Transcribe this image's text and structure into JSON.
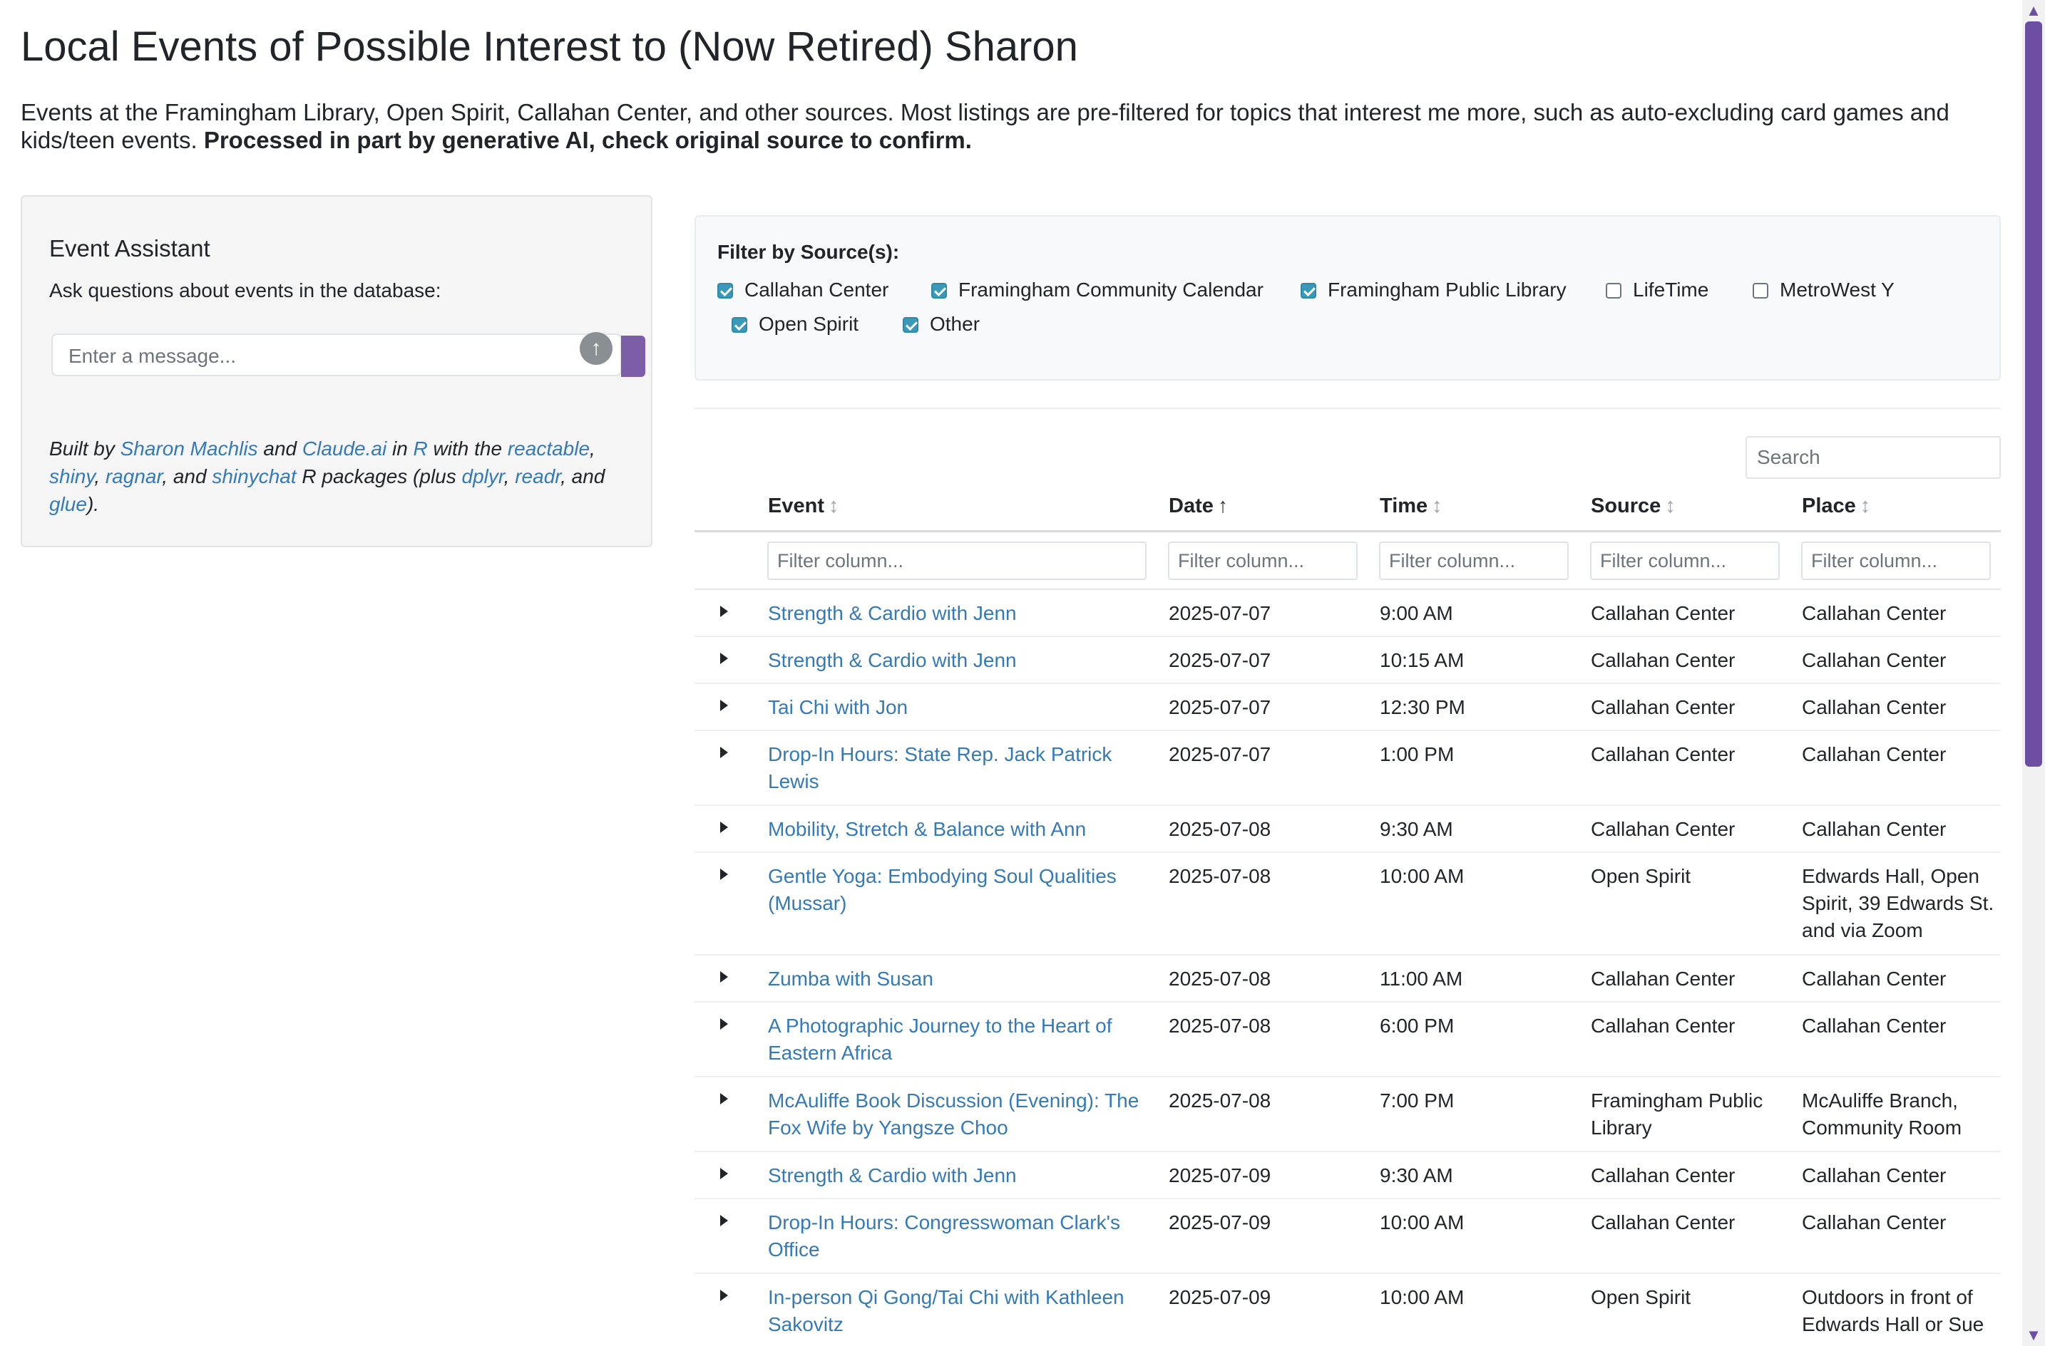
{
  "page": {
    "title": "Local Events of Possible Interest to (Now Retired) Sharon",
    "intro_text": "Events at the Framingham Library, Open Spirit, Callahan Center, and other sources. Most listings are pre-filtered for topics that interest me more, such as auto-excluding card games and kids/teen events. ",
    "intro_bold": "Processed in part by generative AI, check original source to confirm."
  },
  "assistant": {
    "title": "Event Assistant",
    "prompt": "Ask questions about events in the database:",
    "input_placeholder": "Enter a message...",
    "send_icon": "arrow-up-icon",
    "credits": {
      "built_by": "Built by ",
      "author": "Sharon Machlis",
      "and1": " and ",
      "ai": "Claude.ai",
      "in": " in ",
      "lang": "R",
      "with": " with the ",
      "pkg1": "reactable",
      "c1": ", ",
      "pkg2": "shiny",
      "c2": ", ",
      "pkg3": "ragnar",
      "c3": ", and ",
      "pkg4": "shinychat",
      "mid": " R packages (plus ",
      "pkg5": "dplyr",
      "c4": ", ",
      "pkg6": "readr",
      "c5": ", and ",
      "pkg7": "glue",
      "end": ")."
    }
  },
  "filters": {
    "title": "Filter by Source(s):",
    "sources": [
      {
        "label": "Callahan Center",
        "checked": true
      },
      {
        "label": "Framingham Community Calendar",
        "checked": true
      },
      {
        "label": "Framingham Public Library",
        "checked": true
      },
      {
        "label": "LifeTime",
        "checked": false
      },
      {
        "label": "MetroWest Y",
        "checked": false
      },
      {
        "label": "Open Spirit",
        "checked": true
      },
      {
        "label": "Other",
        "checked": true
      }
    ]
  },
  "table": {
    "search_placeholder": "Search",
    "filter_placeholder": "Filter column...",
    "headers": {
      "event": "Event",
      "date": "Date",
      "time": "Time",
      "source": "Source",
      "place": "Place",
      "sort_neutral": "↕",
      "sort_asc": "↑"
    },
    "rows": [
      {
        "event": "Strength & Cardio with Jenn",
        "date": "2025-07-07",
        "time": "9:00 AM",
        "source": "Callahan Center",
        "place": "Callahan Center"
      },
      {
        "event": "Strength & Cardio with Jenn",
        "date": "2025-07-07",
        "time": "10:15 AM",
        "source": "Callahan Center",
        "place": "Callahan Center"
      },
      {
        "event": "Tai Chi with Jon",
        "date": "2025-07-07",
        "time": "12:30 PM",
        "source": "Callahan Center",
        "place": "Callahan Center"
      },
      {
        "event": "Drop-In Hours: State Rep. Jack Patrick Lewis",
        "date": "2025-07-07",
        "time": "1:00 PM",
        "source": "Callahan Center",
        "place": "Callahan Center"
      },
      {
        "event": "Mobility, Stretch & Balance with Ann",
        "date": "2025-07-08",
        "time": "9:30 AM",
        "source": "Callahan Center",
        "place": "Callahan Center"
      },
      {
        "event": "Gentle Yoga: Embodying Soul Qualities (Mussar)",
        "date": "2025-07-08",
        "time": "10:00 AM",
        "source": "Open Spirit",
        "place": "Edwards Hall, Open Spirit, 39 Edwards St. and via Zoom"
      },
      {
        "event": "Zumba with Susan",
        "date": "2025-07-08",
        "time": "11:00 AM",
        "source": "Callahan Center",
        "place": "Callahan Center"
      },
      {
        "event": "A Photographic Journey to the Heart of Eastern Africa",
        "date": "2025-07-08",
        "time": "6:00 PM",
        "source": "Callahan Center",
        "place": "Callahan Center"
      },
      {
        "event": "McAuliffe Book Discussion (Evening): The Fox Wife by Yangsze Choo",
        "date": "2025-07-08",
        "time": "7:00 PM",
        "source": "Framingham Public Library",
        "place": "McAuliffe Branch, Community Room"
      },
      {
        "event": "Strength & Cardio with Jenn",
        "date": "2025-07-09",
        "time": "9:30 AM",
        "source": "Callahan Center",
        "place": "Callahan Center"
      },
      {
        "event": "Drop-In Hours: Congresswoman Clark's Office",
        "date": "2025-07-09",
        "time": "10:00 AM",
        "source": "Callahan Center",
        "place": "Callahan Center"
      },
      {
        "event": "In-person Qi Gong/Tai Chi with Kathleen Sakovitz",
        "date": "2025-07-09",
        "time": "10:00 AM",
        "source": "Open Spirit",
        "place": "Outdoors in front of Edwards Hall or Sue"
      }
    ]
  }
}
